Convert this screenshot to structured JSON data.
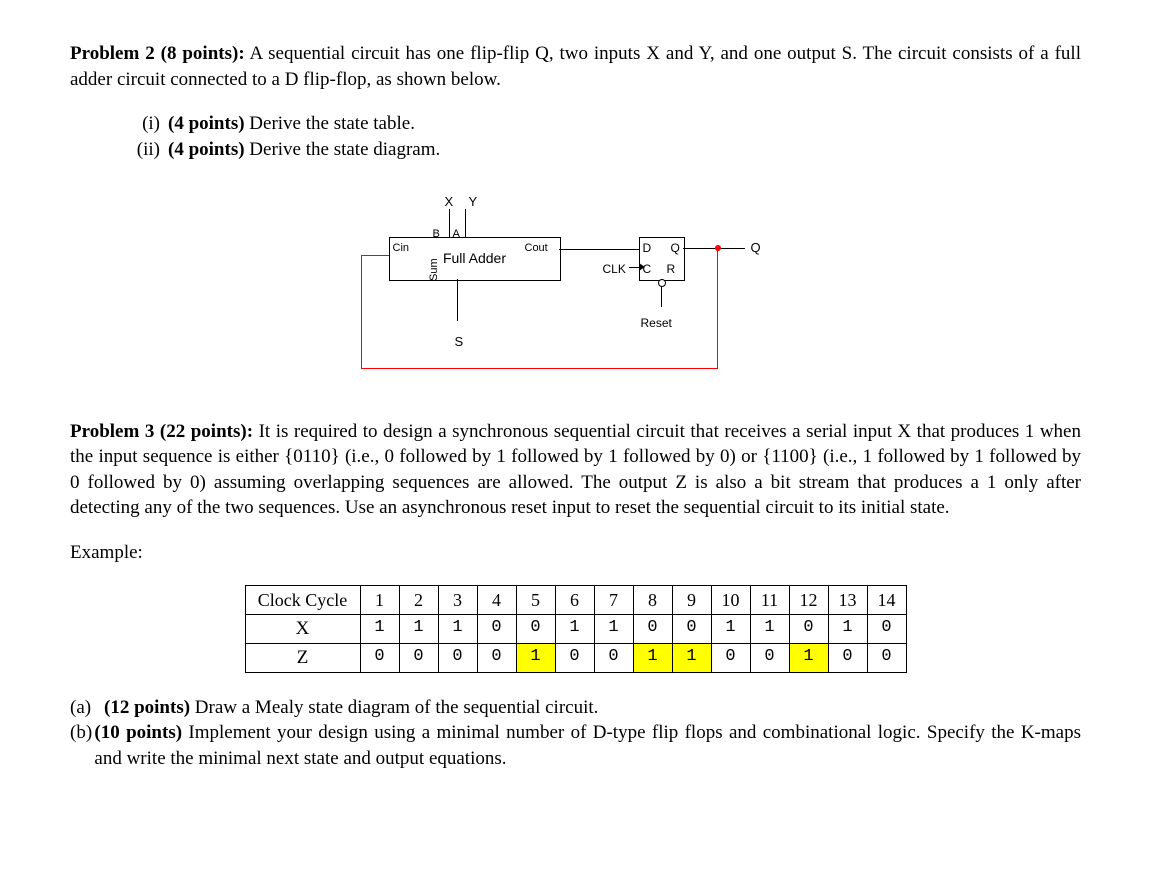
{
  "problem2": {
    "heading_strong": "Problem 2 (8 points):",
    "heading_rest": " A sequential circuit has one flip-flip Q, two inputs X and Y, and one output S. The circuit consists of a full adder circuit connected to a D flip-flop, as shown below.",
    "item_i_num": "(i)",
    "item_i_strong": "(4 points)",
    "item_i_rest": " Derive the state table.",
    "item_ii_num": "(ii)",
    "item_ii_strong": "(4 points)",
    "item_ii_rest": " Derive the state diagram."
  },
  "diagram": {
    "xy": "X Y",
    "b": "B",
    "a": "A",
    "full_adder": "Full Adder",
    "cin": "Cin",
    "cout": "Cout",
    "sum": "Sum",
    "s": "S",
    "d": "D",
    "q_in": "Q",
    "c": "C",
    "r": "R",
    "clk": "CLK",
    "q": "Q",
    "reset": "Reset"
  },
  "problem3": {
    "heading_strong": "Problem 3 (22 points):",
    "heading_rest": " It is required to design a synchronous sequential circuit that receives a serial input X that produces 1 when the input sequence is either {0110} (i.e., 0 followed by 1 followed by 1 followed by 0) or {1100} (i.e., 1 followed by 1 followed by 0 followed by 0) assuming overlapping sequences are allowed. The output Z is also a bit stream that produces a 1 only after detecting any of the two sequences. Use an asynchronous reset input to reset the sequential circuit to its initial state.",
    "example_label": "Example:",
    "part_a_lbl": "(a)",
    "part_a_strong": "(12 points)",
    "part_a_rest": " Draw a Mealy state diagram of the sequential circuit.",
    "part_b_lbl": "(b)",
    "part_b_strong": "(10 points)",
    "part_b_rest": " Implement your design using a minimal number of D-type flip flops and combinational logic. Specify the K-maps and write the minimal next state and output equations."
  },
  "table": {
    "row_headers": [
      "Clock Cycle",
      "X",
      "Z"
    ],
    "clock": [
      "1",
      "2",
      "3",
      "4",
      "5",
      "6",
      "7",
      "8",
      "9",
      "10",
      "11",
      "12",
      "13",
      "14"
    ],
    "x": [
      "1",
      "1",
      "1",
      "0",
      "0",
      "1",
      "1",
      "0",
      "0",
      "1",
      "1",
      "0",
      "1",
      "0"
    ],
    "z": [
      "0",
      "0",
      "0",
      "0",
      "1",
      "0",
      "0",
      "1",
      "1",
      "0",
      "0",
      "1",
      "0",
      "0"
    ],
    "z_highlight_indices": [
      4,
      7,
      8,
      11
    ]
  }
}
